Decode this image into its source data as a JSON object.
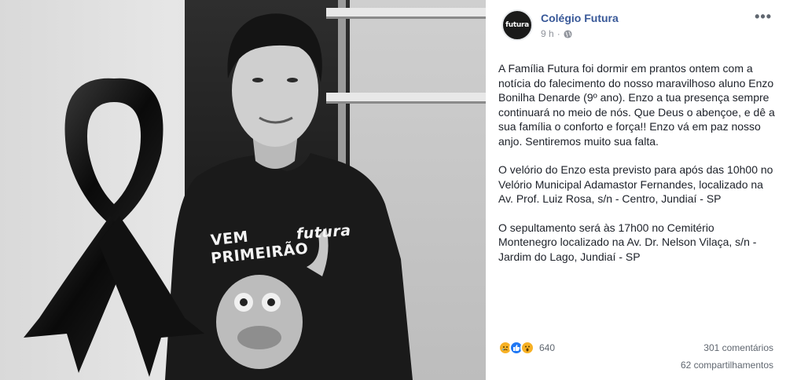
{
  "post": {
    "page_name": "Colégio Futura",
    "avatar_text": "futura",
    "time": "9 h",
    "separator": "·",
    "more_label": "•••",
    "paragraphs": [
      "A Família Futura foi dormir em prantos ontem com a notícia do falecimento do nosso maravilhoso aluno Enzo Bonilha Denarde (9º ano). Enzo a tua presença sempre continuará no meio de nós. Que Deus o abençoe, e dê a sua família o conforto e força!! Enzo vá em paz nosso anjo. Sentiremos muito sua falta.",
      "O velório do Enzo esta previsto para após das 10h00 no Velório Municipal Adamastor Fernandes, localizado na Av. Prof. Luiz Rosa, s/n - Centro, Jundiaí - SP",
      "O sepultamento será às 17h00 no Cemitério Montenegro localizado na Av. Dr. Nelson Vilaça, s/n - Jardim do Lago, Jundiaí - SP"
    ],
    "reactions_count": "640",
    "comments_label": "301 comentários",
    "shares_label": "62 compartilhamentos"
  },
  "photo": {
    "tshirt_line1": "VEM",
    "tshirt_line2": "PRIMEIRÃO",
    "tshirt_logo": "futura"
  },
  "icons": {
    "globe": "globe-icon",
    "more": "more-options-icon",
    "sad": "sad-reaction-icon",
    "like": "like-reaction-icon",
    "wow": "wow-reaction-icon",
    "ribbon": "mourning-ribbon-icon"
  },
  "colors": {
    "link": "#385898",
    "meta": "#90949c",
    "text": "#1d2129",
    "like": "#2078f4",
    "emoji": "#f7b125"
  }
}
